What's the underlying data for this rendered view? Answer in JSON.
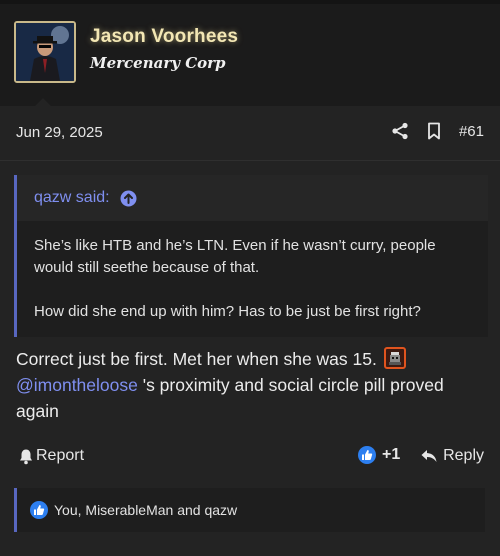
{
  "user": {
    "name": "Jason Voorhees",
    "title": "Mercenary Corp"
  },
  "post": {
    "date": "Jun 29, 2025",
    "number": "#61",
    "icons": [
      "share-icon",
      "bookmark-icon"
    ]
  },
  "quote": {
    "author_label": "qazw said:",
    "lines": [
      "She’s like HTB and he’s LTN. Even if he wasn’t curry, people would still seethe because of that.",
      "How did she end up with him? Has to be just be first right?"
    ]
  },
  "message": {
    "text_before": "Correct just be first. Met her when she was 15.",
    "mention": "@imontheloose",
    "text_after": " 's proximity and social circle pill proved again"
  },
  "actions": {
    "report_label": "Report",
    "reaction_count": "+1",
    "reply_label": "Reply"
  },
  "reactions": {
    "summary": "You, MiserableMan and qazw"
  },
  "colors": {
    "accent": "#7f8ff0",
    "quote_border": "#5867c0",
    "username": "#f3e7b4",
    "like_blue": "#2d7ff0"
  }
}
